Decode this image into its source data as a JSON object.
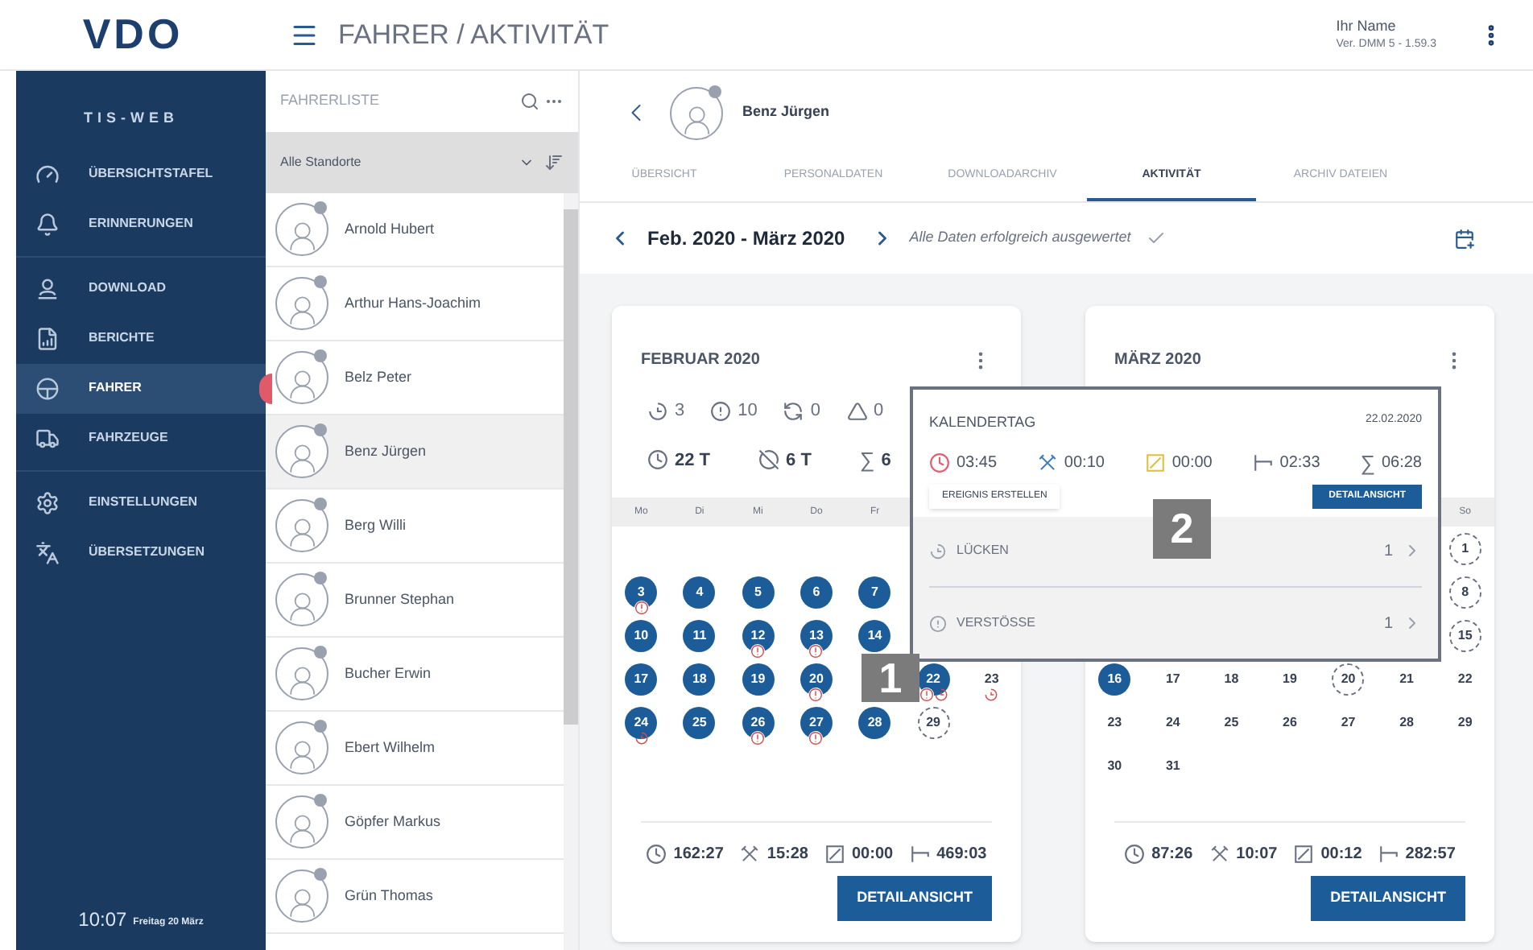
{
  "header": {
    "logo": "VDO",
    "title": "FAHRER / AKTIVITÄT",
    "user_name": "Ihr Name",
    "version": "Ver. DMM 5 - 1.59.3"
  },
  "sidebar": {
    "brand": "TIS-WEB",
    "groups": [
      [
        {
          "kind": "dashboard",
          "label": "ÜBERSICHTSTAFEL",
          "selected": false
        },
        {
          "kind": "reminders",
          "label": "ERINNERUNGEN",
          "selected": false
        }
      ],
      [
        {
          "kind": "download",
          "label": "DOWNLOAD",
          "selected": false
        },
        {
          "kind": "reports",
          "label": "BERICHTE",
          "selected": false
        },
        {
          "kind": "drivers",
          "label": "FAHRER",
          "selected": true
        },
        {
          "kind": "vehicles",
          "label": "FAHRZEUGE",
          "selected": false
        }
      ],
      [
        {
          "kind": "settings",
          "label": "EINSTELLUNGEN",
          "selected": false
        },
        {
          "kind": "translations",
          "label": "ÜBERSETZUNGEN",
          "selected": false
        }
      ]
    ],
    "time": "10:07",
    "date": "Freitag 20 März"
  },
  "driver_list": {
    "title": "FAHRERLISTE",
    "filter": "Alle Standorte",
    "drivers": [
      {
        "name": "Arnold Hubert",
        "selected": false
      },
      {
        "name": "Arthur Hans-Joachim",
        "selected": false
      },
      {
        "name": "Belz Peter",
        "selected": false
      },
      {
        "name": "Benz Jürgen",
        "selected": true
      },
      {
        "name": "Berg Willi",
        "selected": false
      },
      {
        "name": "Brunner Stephan",
        "selected": false
      },
      {
        "name": "Bucher Erwin",
        "selected": false
      },
      {
        "name": "Ebert Wilhelm",
        "selected": false
      },
      {
        "name": "Göpfer Markus",
        "selected": false
      },
      {
        "name": "Grün Thomas",
        "selected": false
      }
    ]
  },
  "profile": {
    "name": "Benz Jürgen"
  },
  "tabs": [
    {
      "label": "ÜBERSICHT",
      "selected": false
    },
    {
      "label": "PERSONALDATEN",
      "selected": false
    },
    {
      "label": "DOWNLOADARCHIV",
      "selected": false
    },
    {
      "label": "AKTIVITÄT",
      "selected": true
    },
    {
      "label": "ARCHIV DATEIEN",
      "selected": false
    }
  ],
  "period": {
    "label": "Feb. 2020 - März 2020",
    "status": "Alle Daten erfolgreich ausgewertet"
  },
  "months": [
    {
      "title": "FEBRUAR 2020",
      "counts": [
        {
          "kind": "gaps",
          "value": "3"
        },
        {
          "kind": "violations",
          "value": "10"
        },
        {
          "kind": "exchange",
          "value": "0"
        },
        {
          "kind": "warnings",
          "value": "0"
        }
      ],
      "days_summary": [
        {
          "kind": "drive",
          "value": "22 T"
        },
        {
          "kind": "rest_day",
          "value": "6 T"
        },
        {
          "kind": "total",
          "icon": "∑",
          "value": "6"
        }
      ],
      "weekdays": {
        "mon": "Mo",
        "tue": "Di",
        "wed": "Mi",
        "thu": "Do",
        "fri": "Fr"
      },
      "weeks": [
        {
          "mon": {
            "day": "3",
            "kind": "filled",
            "violation": true,
            "gap": false
          },
          "tue": {
            "day": "4",
            "kind": "filled",
            "violation": false,
            "gap": false
          },
          "wed": {
            "day": "5",
            "kind": "filled",
            "violation": false,
            "gap": false
          },
          "thu": {
            "day": "6",
            "kind": "filled",
            "violation": false,
            "gap": false
          },
          "fri": {
            "day": "7",
            "kind": "filled",
            "violation": false,
            "gap": false
          }
        },
        {
          "mon": {
            "day": "10",
            "kind": "filled",
            "violation": false,
            "gap": false
          },
          "tue": {
            "day": "11",
            "kind": "filled",
            "violation": false,
            "gap": false
          },
          "wed": {
            "day": "12",
            "kind": "filled",
            "violation": true,
            "gap": false
          },
          "thu": {
            "day": "13",
            "kind": "filled",
            "violation": true,
            "gap": false
          },
          "fri": {
            "day": "14",
            "kind": "filled",
            "violation": false,
            "gap": false
          }
        },
        {
          "mon": {
            "day": "17",
            "kind": "filled",
            "violation": false,
            "gap": false
          },
          "tue": {
            "day": "18",
            "kind": "filled",
            "violation": false,
            "gap": false
          },
          "wed": {
            "day": "19",
            "kind": "filled",
            "violation": false,
            "gap": false
          },
          "thu": {
            "day": "20",
            "kind": "filled",
            "violation": true,
            "gap": false
          },
          "sat": {
            "day": "22",
            "kind": "filled",
            "violation": true,
            "gap": true
          },
          "sun": {
            "day": "23",
            "kind": "plain",
            "violation": false,
            "gap": true
          }
        },
        {
          "mon": {
            "day": "24",
            "kind": "filled",
            "violation": false,
            "gap": true
          },
          "tue": {
            "day": "25",
            "kind": "filled",
            "violation": false,
            "gap": false
          },
          "wed": {
            "day": "26",
            "kind": "filled",
            "violation": true,
            "gap": false
          },
          "thu": {
            "day": "27",
            "kind": "filled",
            "violation": true,
            "gap": false
          },
          "fri": {
            "day": "28",
            "kind": "filled",
            "violation": false,
            "gap": false
          },
          "sat": {
            "day": "29",
            "kind": "outlined",
            "violation": false,
            "gap": false
          }
        }
      ],
      "totals": [
        {
          "kind": "drive",
          "value": "162:27"
        },
        {
          "kind": "work",
          "value": "15:28"
        },
        {
          "kind": "availability",
          "value": "00:00"
        },
        {
          "kind": "rest",
          "value": "469:03"
        }
      ],
      "button": "DETAILANSICHT"
    },
    {
      "title": "MÄRZ 2020",
      "weekdays": {
        "sun": "So"
      },
      "weeks": [
        {
          "sun": {
            "day": "1",
            "kind": "outlined",
            "violation": false,
            "gap": false
          }
        },
        {
          "sun": {
            "day": "8",
            "kind": "outlined",
            "violation": false,
            "gap": false
          }
        },
        {
          "sun": {
            "day": "15",
            "kind": "outlined",
            "violation": false,
            "gap": false
          }
        },
        {
          "mon": {
            "day": "16",
            "kind": "filled",
            "violation": false,
            "gap": false
          },
          "tue": {
            "day": "17",
            "kind": "plain",
            "violation": false,
            "gap": false
          },
          "wed": {
            "day": "18",
            "kind": "plain",
            "violation": false,
            "gap": false
          },
          "thu": {
            "day": "19",
            "kind": "plain",
            "violation": false,
            "gap": false
          },
          "fri": {
            "day": "20",
            "kind": "outlined",
            "violation": false,
            "gap": false
          },
          "sat": {
            "day": "21",
            "kind": "plain",
            "violation": false,
            "gap": false
          },
          "sun": {
            "day": "22",
            "kind": "plain",
            "violation": false,
            "gap": false
          }
        },
        {
          "mon": {
            "day": "23",
            "kind": "plain",
            "violation": false,
            "gap": false
          },
          "tue": {
            "day": "24",
            "kind": "plain",
            "violation": false,
            "gap": false
          },
          "wed": {
            "day": "25",
            "kind": "plain",
            "violation": false,
            "gap": false
          },
          "thu": {
            "day": "26",
            "kind": "plain",
            "violation": false,
            "gap": false
          },
          "fri": {
            "day": "27",
            "kind": "plain",
            "violation": false,
            "gap": false
          },
          "sat": {
            "day": "28",
            "kind": "plain",
            "violation": false,
            "gap": false
          },
          "sun": {
            "day": "29",
            "kind": "plain",
            "violation": false,
            "gap": false
          }
        },
        {
          "mon": {
            "day": "30",
            "kind": "plain",
            "violation": false,
            "gap": false
          },
          "tue": {
            "day": "31",
            "kind": "plain",
            "violation": false,
            "gap": false
          }
        }
      ],
      "totals": [
        {
          "kind": "drive",
          "value": "87:26"
        },
        {
          "kind": "work",
          "value": "10:07"
        },
        {
          "kind": "availability",
          "value": "00:12"
        },
        {
          "kind": "rest",
          "value": "282:57"
        }
      ],
      "button": "DETAILANSICHT"
    }
  ],
  "day_popup": {
    "title": "KALENDERTAG",
    "date": "22.02.2020",
    "stats": [
      {
        "kind": "drive",
        "value": "03:45"
      },
      {
        "kind": "work",
        "value": "00:10"
      },
      {
        "kind": "availability",
        "value": "00:00"
      },
      {
        "kind": "rest",
        "value": "02:33"
      },
      {
        "kind": "total",
        "icon": "∑",
        "value": "06:28"
      }
    ],
    "create_button": "EREIGNIS ERSTELLEN",
    "detail_button": "DETAILANSICHT",
    "sections": [
      {
        "kind": "gaps",
        "label": "LÜCKEN",
        "count": "1"
      },
      {
        "kind": "violations",
        "label": "VERSTÖSSE",
        "count": "1"
      }
    ]
  },
  "callouts": [
    {
      "label": "1"
    },
    {
      "label": "2"
    }
  ]
}
